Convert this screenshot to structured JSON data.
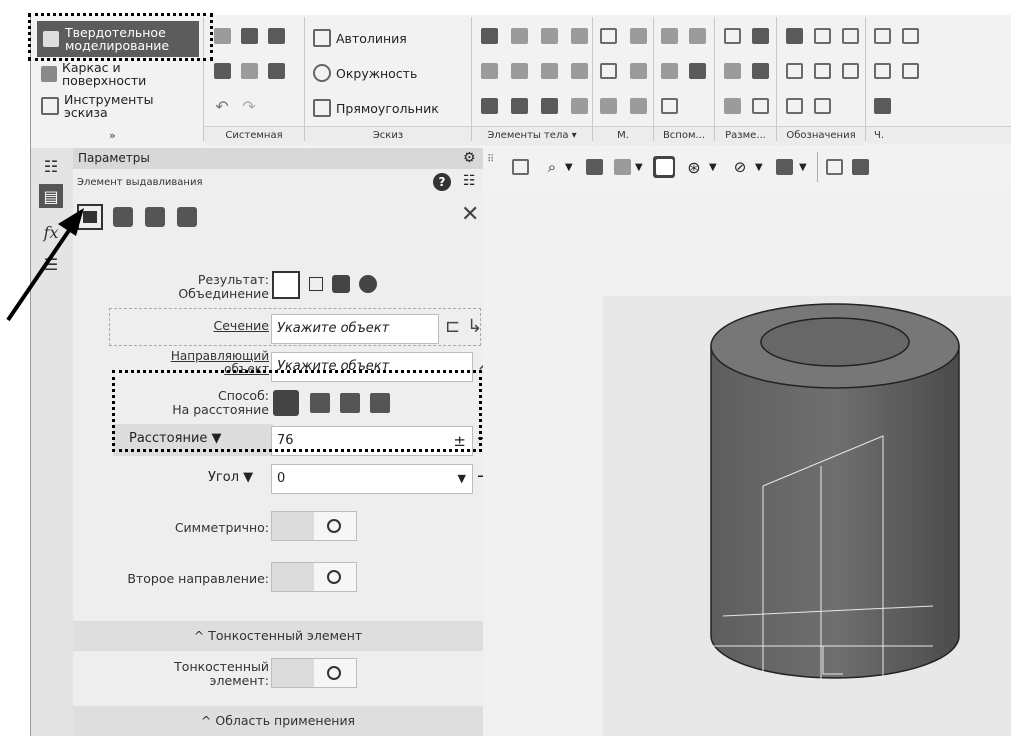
{
  "ribbon": {
    "items": [
      "Твердотельное моделирование",
      "Каркас и поверхности",
      "Инструменты эскиза"
    ],
    "sketch_items": [
      "Автолиния",
      "Окружность",
      "Прямоугольник"
    ],
    "groups": [
      "Системная",
      "Эскиз",
      "Элементы тела",
      "М.",
      "Вспом...",
      "Разме...",
      "Обозначения",
      "Ч."
    ]
  },
  "panel": {
    "header": "Параметры",
    "subtitle": "Элемент выдавливания",
    "result_label": "Результат:",
    "result_value": "Объединение",
    "section_label": "Сечение",
    "section_placeholder": "Укажите объект",
    "guide_label": "Направляющий объект",
    "guide_placeholder": "Укажите объект",
    "method_label": "Способ:",
    "method_value": "На расстояние",
    "distance_label": "Расстояние",
    "distance_value": "76",
    "plusminus": "±",
    "arrow": "→",
    "angle_label": "Угол",
    "angle_value": "0",
    "symmetric_label": "Симметрично:",
    "second_dir_label": "Второе направление:",
    "thinwall_section": "Тонкостенный элемент",
    "thinwall_label": "Тонкостенный элемент:",
    "scope_section": "Область применения"
  },
  "icons": [
    "solid-modeling-icon",
    "wireframe-icon",
    "sketch-tools-icon",
    "open-icon",
    "save-icon",
    "print-icon",
    "undo-icon",
    "redo-icon",
    "help-icon",
    "tree-icon",
    "close-icon",
    "gear-icon",
    "fx-icon",
    "extrude-icon",
    "rotate-icon",
    "lofted-icon",
    "kinematic-icon"
  ]
}
